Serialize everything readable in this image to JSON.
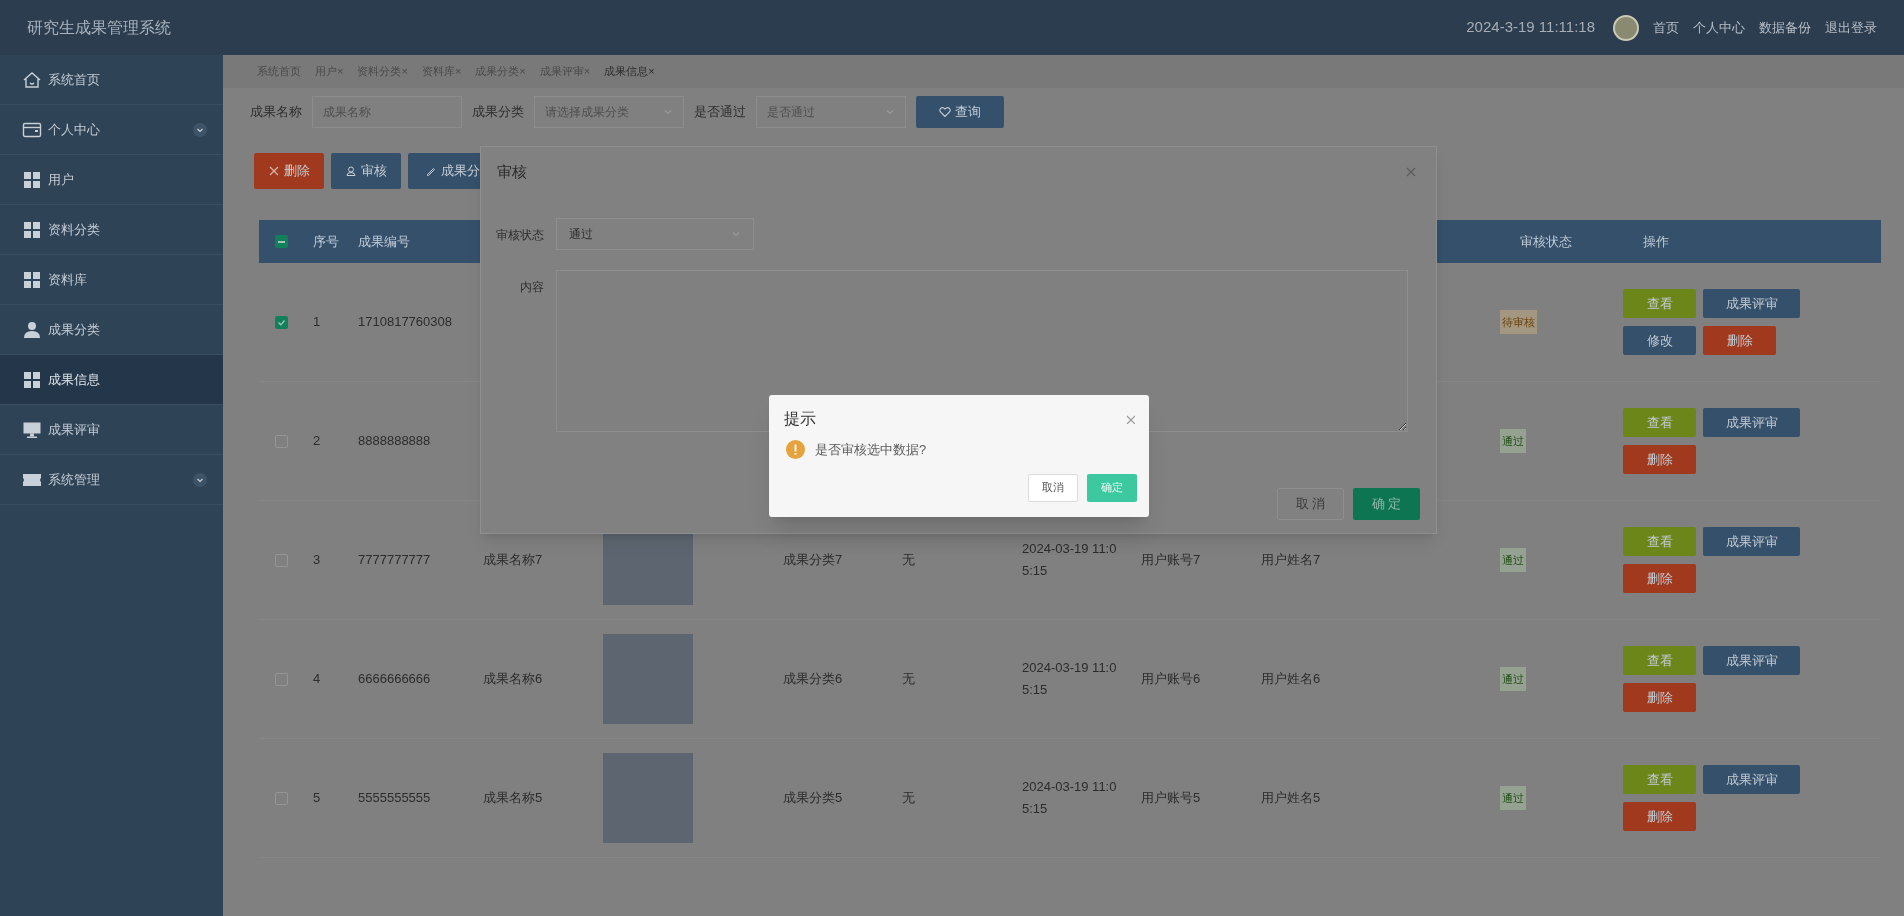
{
  "header": {
    "title": "研究生成果管理系统",
    "datetime": "2024-3-19 11:11:18",
    "links": [
      "首页",
      "个人中心",
      "数据备份",
      "退出登录"
    ]
  },
  "sidebar": {
    "items": [
      {
        "label": "系统首页",
        "selected": false,
        "expandable": false
      },
      {
        "label": "个人中心",
        "selected": false,
        "expandable": true
      },
      {
        "label": "用户",
        "selected": false,
        "expandable": false
      },
      {
        "label": "资料分类",
        "selected": false,
        "expandable": false
      },
      {
        "label": "资料库",
        "selected": false,
        "expandable": false
      },
      {
        "label": "成果分类",
        "selected": false,
        "expandable": false
      },
      {
        "label": "成果信息",
        "selected": true,
        "expandable": false
      },
      {
        "label": "成果评审",
        "selected": false,
        "expandable": false
      },
      {
        "label": "系统管理",
        "selected": false,
        "expandable": true
      }
    ]
  },
  "breadcrumb": {
    "tabs": [
      {
        "label": "系统首页",
        "selected": false
      },
      {
        "label": "用户",
        "close": "×",
        "selected": false
      },
      {
        "label": "资料分类",
        "close": "×",
        "selected": false
      },
      {
        "label": "资料库",
        "close": "×",
        "selected": false
      },
      {
        "label": "成果分类",
        "close": "×",
        "selected": false
      },
      {
        "label": "成果评审",
        "close": "×",
        "selected": false
      },
      {
        "label": "成果信息",
        "close": "×",
        "selected": true
      }
    ]
  },
  "search": {
    "fields": [
      {
        "label": "成果名称",
        "kind": "input",
        "placeholder": "成果名称"
      },
      {
        "label": "成果分类",
        "kind": "select",
        "placeholder": "请选择成果分类"
      },
      {
        "label": "是否通过",
        "kind": "select",
        "placeholder": "是否通过"
      }
    ],
    "button": "查询"
  },
  "toolbar": [
    {
      "label": "删除",
      "kind": "danger"
    },
    {
      "label": "审核",
      "kind": "audit"
    },
    {
      "label": "成果分",
      "kind": "edit"
    }
  ],
  "table": {
    "header_checkbox": {
      "indeterminate": true
    },
    "columns": [
      "序号",
      "成果编号",
      "审核状态",
      "操作"
    ],
    "rows": [
      {
        "checked": true,
        "index": "1",
        "code": "1710817760308",
        "status": {
          "text": "待审核",
          "kind": "pending"
        },
        "actions": [
          {
            "label": "查看",
            "kind": "view"
          },
          {
            "label": "成果评审",
            "kind": "review"
          },
          {
            "label": "修改",
            "kind": "edit"
          },
          {
            "label": "删除",
            "kind": "delete"
          }
        ]
      },
      {
        "checked": false,
        "index": "2",
        "code": "8888888888",
        "status": {
          "text": "通过",
          "kind": "passed"
        },
        "actions": [
          {
            "label": "查看",
            "kind": "view"
          },
          {
            "label": "成果评审",
            "kind": "review"
          },
          {
            "label": "删除",
            "kind": "delete"
          }
        ]
      },
      {
        "checked": false,
        "index": "3",
        "code": "7777777777",
        "name": "成果名称7",
        "image": true,
        "category": "成果分类7",
        "remark": "无",
        "time": "2024-03-19 11:05:15",
        "account": "用户账号7",
        "username": "用户姓名7",
        "status": {
          "text": "通过",
          "kind": "passed"
        },
        "actions": [
          {
            "label": "查看",
            "kind": "view"
          },
          {
            "label": "成果评审",
            "kind": "review"
          },
          {
            "label": "删除",
            "kind": "delete"
          }
        ]
      },
      {
        "checked": false,
        "index": "4",
        "code": "6666666666",
        "name": "成果名称6",
        "image": true,
        "category": "成果分类6",
        "remark": "无",
        "time": "2024-03-19 11:05:15",
        "account": "用户账号6",
        "username": "用户姓名6",
        "status": {
          "text": "通过",
          "kind": "passed"
        },
        "actions": [
          {
            "label": "查看",
            "kind": "view"
          },
          {
            "label": "成果评审",
            "kind": "review"
          },
          {
            "label": "删除",
            "kind": "delete"
          }
        ]
      },
      {
        "checked": false,
        "index": "5",
        "code": "5555555555",
        "name": "成果名称5",
        "image": true,
        "category": "成果分类5",
        "remark": "无",
        "time": "2024-03-19 11:05:15",
        "account": "用户账号5",
        "username": "用户姓名5",
        "status": {
          "text": "通过",
          "kind": "passed"
        },
        "actions": [
          {
            "label": "查看",
            "kind": "view"
          },
          {
            "label": "成果评审",
            "kind": "review"
          },
          {
            "label": "删除",
            "kind": "delete"
          }
        ]
      }
    ]
  },
  "audit_modal": {
    "title": "审核",
    "fields": [
      {
        "label": "审核状态",
        "kind": "select",
        "value": "通过"
      },
      {
        "label": "内容",
        "kind": "textarea"
      }
    ],
    "buttons": [
      {
        "label": "取 消",
        "kind": "default"
      },
      {
        "label": "确 定",
        "kind": "primary"
      }
    ]
  },
  "confirm_dialog": {
    "title": "提示",
    "message": "是否审核选中数据?",
    "buttons": [
      {
        "label": "取消",
        "kind": "default"
      },
      {
        "label": "确定",
        "kind": "primary"
      }
    ]
  }
}
